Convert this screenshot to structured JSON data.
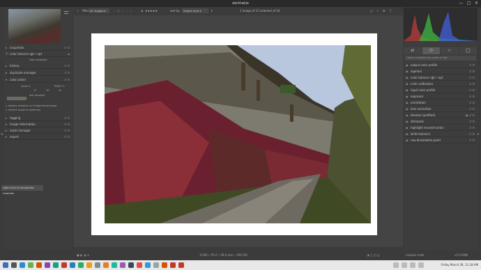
{
  "window": {
    "title": "darktable",
    "minimize": "—",
    "maximize": "□",
    "close": "✕"
  },
  "left_panel": {
    "modules": [
      {
        "label": "snapshots",
        "arrow": "▸"
      },
      {
        "label": "color balance rgb • opt",
        "arrow": "▸",
        "sub": "take snapshot"
      },
      {
        "label": "history",
        "arrow": "▸"
      },
      {
        "label": "duplicate manager",
        "arrow": "▸"
      },
      {
        "label": "color picker",
        "arrow": "▾"
      }
    ],
    "picker": {
      "mode": "mean",
      "model": "RGB",
      "values": [
        "17",
        "10",
        "12"
      ],
      "live_samples": "live samples",
      "option1": "display samples on image/vectorscope",
      "option2": "restrict scope to selection"
    },
    "lower_modules": [
      {
        "label": "tagging",
        "arrow": "▸"
      },
      {
        "label": "image information",
        "arrow": "▸"
      },
      {
        "label": "mask manager",
        "arrow": "▸"
      },
      {
        "label": "export",
        "arrow": "▸"
      }
    ],
    "tooltip": "right-click to show/hide modules"
  },
  "toolbar": {
    "filter_label": "filter",
    "filter_value": "all images",
    "rating": "★★★★★",
    "sort_label": "sort by",
    "sort_value": "import time",
    "count_text": "1 image of 12 selected of 54"
  },
  "right_panel": {
    "tabs": [
      "⇄",
      "⏻",
      "☆",
      "◯"
    ],
    "search_placeholder": "search modules by name or tag",
    "modules": [
      "output color profile",
      "sigmoid",
      "color balance rgb • opt",
      "color calibration",
      "input color profile",
      "exposure",
      "orientation",
      "lens correction",
      "denoise (profiled)",
      "demosaic",
      "highlight reconstruction",
      "white balance",
      "raw black/white point"
    ],
    "module_order_label": "module order",
    "module_order_value": "v3.0 RAW"
  },
  "status_bar": {
    "exif": "1/160 • f/5.0 • 28.0 mm • 200 ISO"
  },
  "taskbar": {
    "clock": "Friday March 28, 11:18 AM"
  }
}
